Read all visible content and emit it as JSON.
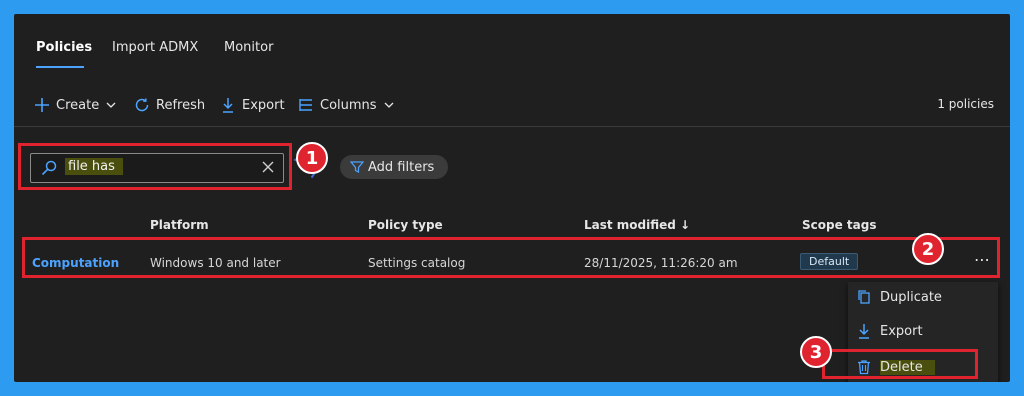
{
  "tabs": [
    {
      "label": "Policies",
      "active": true
    },
    {
      "label": "Import ADMX",
      "active": false
    },
    {
      "label": "Monitor",
      "active": false
    }
  ],
  "toolbar": {
    "create_label": "Create",
    "refresh_label": "Refresh",
    "export_label": "Export",
    "columns_label": "Columns",
    "count_label": "1 policies"
  },
  "search": {
    "value": "file has",
    "placeholder": ""
  },
  "filters": {
    "add_label": "Add filters"
  },
  "table": {
    "columns": [
      "Platform",
      "Policy type",
      "Last modified ↓",
      "Scope tags"
    ],
    "rows": [
      {
        "name": "Computation",
        "platform": "Windows 10 and later",
        "policy_type": "Settings catalog",
        "last_modified": "28/11/2025, 11:26:20 am",
        "scope_tag": "Default"
      }
    ]
  },
  "context_menu": {
    "items": [
      {
        "label": "Duplicate",
        "icon": "duplicate-icon"
      },
      {
        "label": "Export",
        "icon": "export-icon"
      },
      {
        "label": "Delete",
        "icon": "delete-icon"
      }
    ]
  },
  "annotations": {
    "one": "1",
    "two": "2",
    "three": "3"
  },
  "colors": {
    "accent": "#4ca3ff",
    "annotation_red": "#e0242f",
    "frame_blue": "#2d9bef",
    "highlight": "#4a4f0e"
  }
}
